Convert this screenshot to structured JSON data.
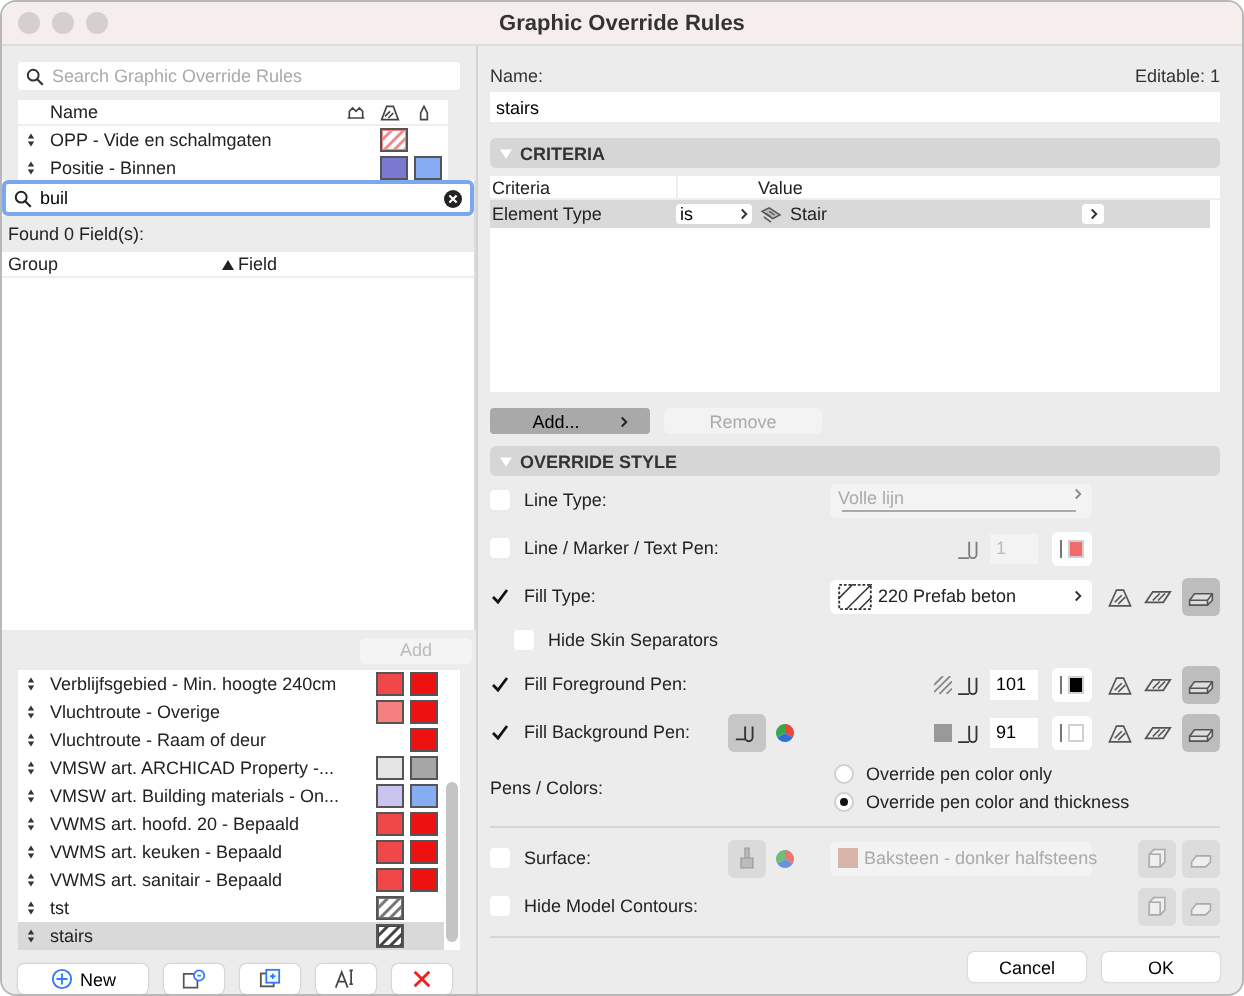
{
  "window": {
    "title": "Graphic Override Rules"
  },
  "search": {
    "placeholder": "Search Graphic Override Rules"
  },
  "rules_header": {
    "name": "Name"
  },
  "rules_top": [
    {
      "name": "OPP - Vide en schalmgaten",
      "selected": false,
      "swatches": [
        {
          "kind": "hatch",
          "color": "#f08a8a"
        },
        {
          "kind": "empty"
        }
      ]
    },
    {
      "name": "Positie - Binnen",
      "selected": false,
      "swatches": [
        {
          "kind": "solid",
          "color": "#7b78d0"
        },
        {
          "kind": "solid",
          "color": "#86acf4"
        }
      ]
    }
  ],
  "field_search": {
    "value": "buil",
    "found": "Found 0 Field(s):",
    "columns": [
      "Group",
      "Field"
    ]
  },
  "add_button": {
    "label": "Add",
    "disabled": true
  },
  "rules_bottom": [
    {
      "name": "Verblijfsgebied - Min. hoogte 240cm",
      "selected": false,
      "swatches": [
        {
          "kind": "solid",
          "color": "#f04848"
        },
        {
          "kind": "solid",
          "color": "#ee1111"
        }
      ]
    },
    {
      "name": "Vluchtroute - Overige",
      "selected": false,
      "swatches": [
        {
          "kind": "solid",
          "color": "#f58080"
        },
        {
          "kind": "solid",
          "color": "#ee1111"
        }
      ]
    },
    {
      "name": "Vluchtroute - Raam of deur",
      "selected": false,
      "swatches": [
        {
          "kind": "empty"
        },
        {
          "kind": "solid",
          "color": "#ee1111"
        }
      ]
    },
    {
      "name": "VMSW art. ARCHICAD Property -...",
      "selected": false,
      "swatches": [
        {
          "kind": "solid",
          "color": "#e4e4e4"
        },
        {
          "kind": "solid",
          "color": "#a6a6a6"
        }
      ]
    },
    {
      "name": "VMSW art. Building materials - On...",
      "selected": false,
      "swatches": [
        {
          "kind": "solid",
          "color": "#c9c5ef"
        },
        {
          "kind": "solid",
          "color": "#86acf4"
        }
      ]
    },
    {
      "name": "VWMS art. hoofd. 20 - Bepaald",
      "selected": false,
      "swatches": [
        {
          "kind": "solid",
          "color": "#f04848"
        },
        {
          "kind": "solid",
          "color": "#ee1111"
        }
      ]
    },
    {
      "name": "VWMS art. keuken - Bepaald",
      "selected": false,
      "swatches": [
        {
          "kind": "solid",
          "color": "#f04848"
        },
        {
          "kind": "solid",
          "color": "#ee1111"
        }
      ]
    },
    {
      "name": "VWMS art. sanitair - Bepaald",
      "selected": false,
      "swatches": [
        {
          "kind": "solid",
          "color": "#f04848"
        },
        {
          "kind": "solid",
          "color": "#ee1111"
        }
      ]
    },
    {
      "name": "tst",
      "selected": false,
      "swatches": [
        {
          "kind": "hatch",
          "color": "#777777"
        },
        {
          "kind": "empty"
        }
      ]
    },
    {
      "name": "stairs",
      "selected": true,
      "swatches": [
        {
          "kind": "hatch",
          "color": "#444444"
        },
        {
          "kind": "empty"
        }
      ]
    }
  ],
  "new_button": {
    "label": "New"
  },
  "name_label": "Name:",
  "editable": "Editable: 1",
  "name_value": "stairs",
  "criteria": {
    "title": "CRITERIA",
    "expanded": true,
    "columns": [
      "Criteria",
      "Value"
    ],
    "rows": [
      {
        "criteria": "Element Type",
        "operator": "is",
        "value": "Stair",
        "selected": true
      }
    ],
    "add": "Add...",
    "remove": "Remove",
    "remove_disabled": true
  },
  "override_style": {
    "title": "OVERRIDE STYLE",
    "expanded": true,
    "rows": [
      {
        "kind": "dropdown",
        "label": "Line Type:",
        "checked": false,
        "value": "Volle lijn"
      },
      {
        "kind": "pen",
        "label": "Line / Marker / Text Pen:",
        "checked": false,
        "pen": "1",
        "color": "#f26b6b"
      },
      {
        "kind": "fill",
        "label": "Fill Type:",
        "checked": true,
        "value": "220 Prefab beton",
        "children": [
          {
            "label": "Hide Skin Separators",
            "checked": false
          }
        ]
      },
      {
        "kind": "fgpen",
        "label": "Fill Foreground Pen:",
        "checked": true,
        "pen": "101",
        "color": "#000000"
      },
      {
        "kind": "bgpen",
        "label": "Fill Background Pen:",
        "checked": true,
        "pen": "91",
        "color": "#ffffff"
      },
      {
        "kind": "radio",
        "label": "Pens / Colors:",
        "options": [
          {
            "label": "Override pen color only",
            "selected": false
          },
          {
            "label": "Override pen color and thickness",
            "selected": true
          }
        ]
      },
      {
        "kind": "surface",
        "label": "Surface:",
        "checked": false,
        "value": "Baksteen - donker halfsteens",
        "color": "#d9b2a8"
      },
      {
        "kind": "contours",
        "label": "Hide Model Contours:",
        "checked": false
      }
    ]
  },
  "buttons": [
    "Cancel",
    "OK"
  ]
}
